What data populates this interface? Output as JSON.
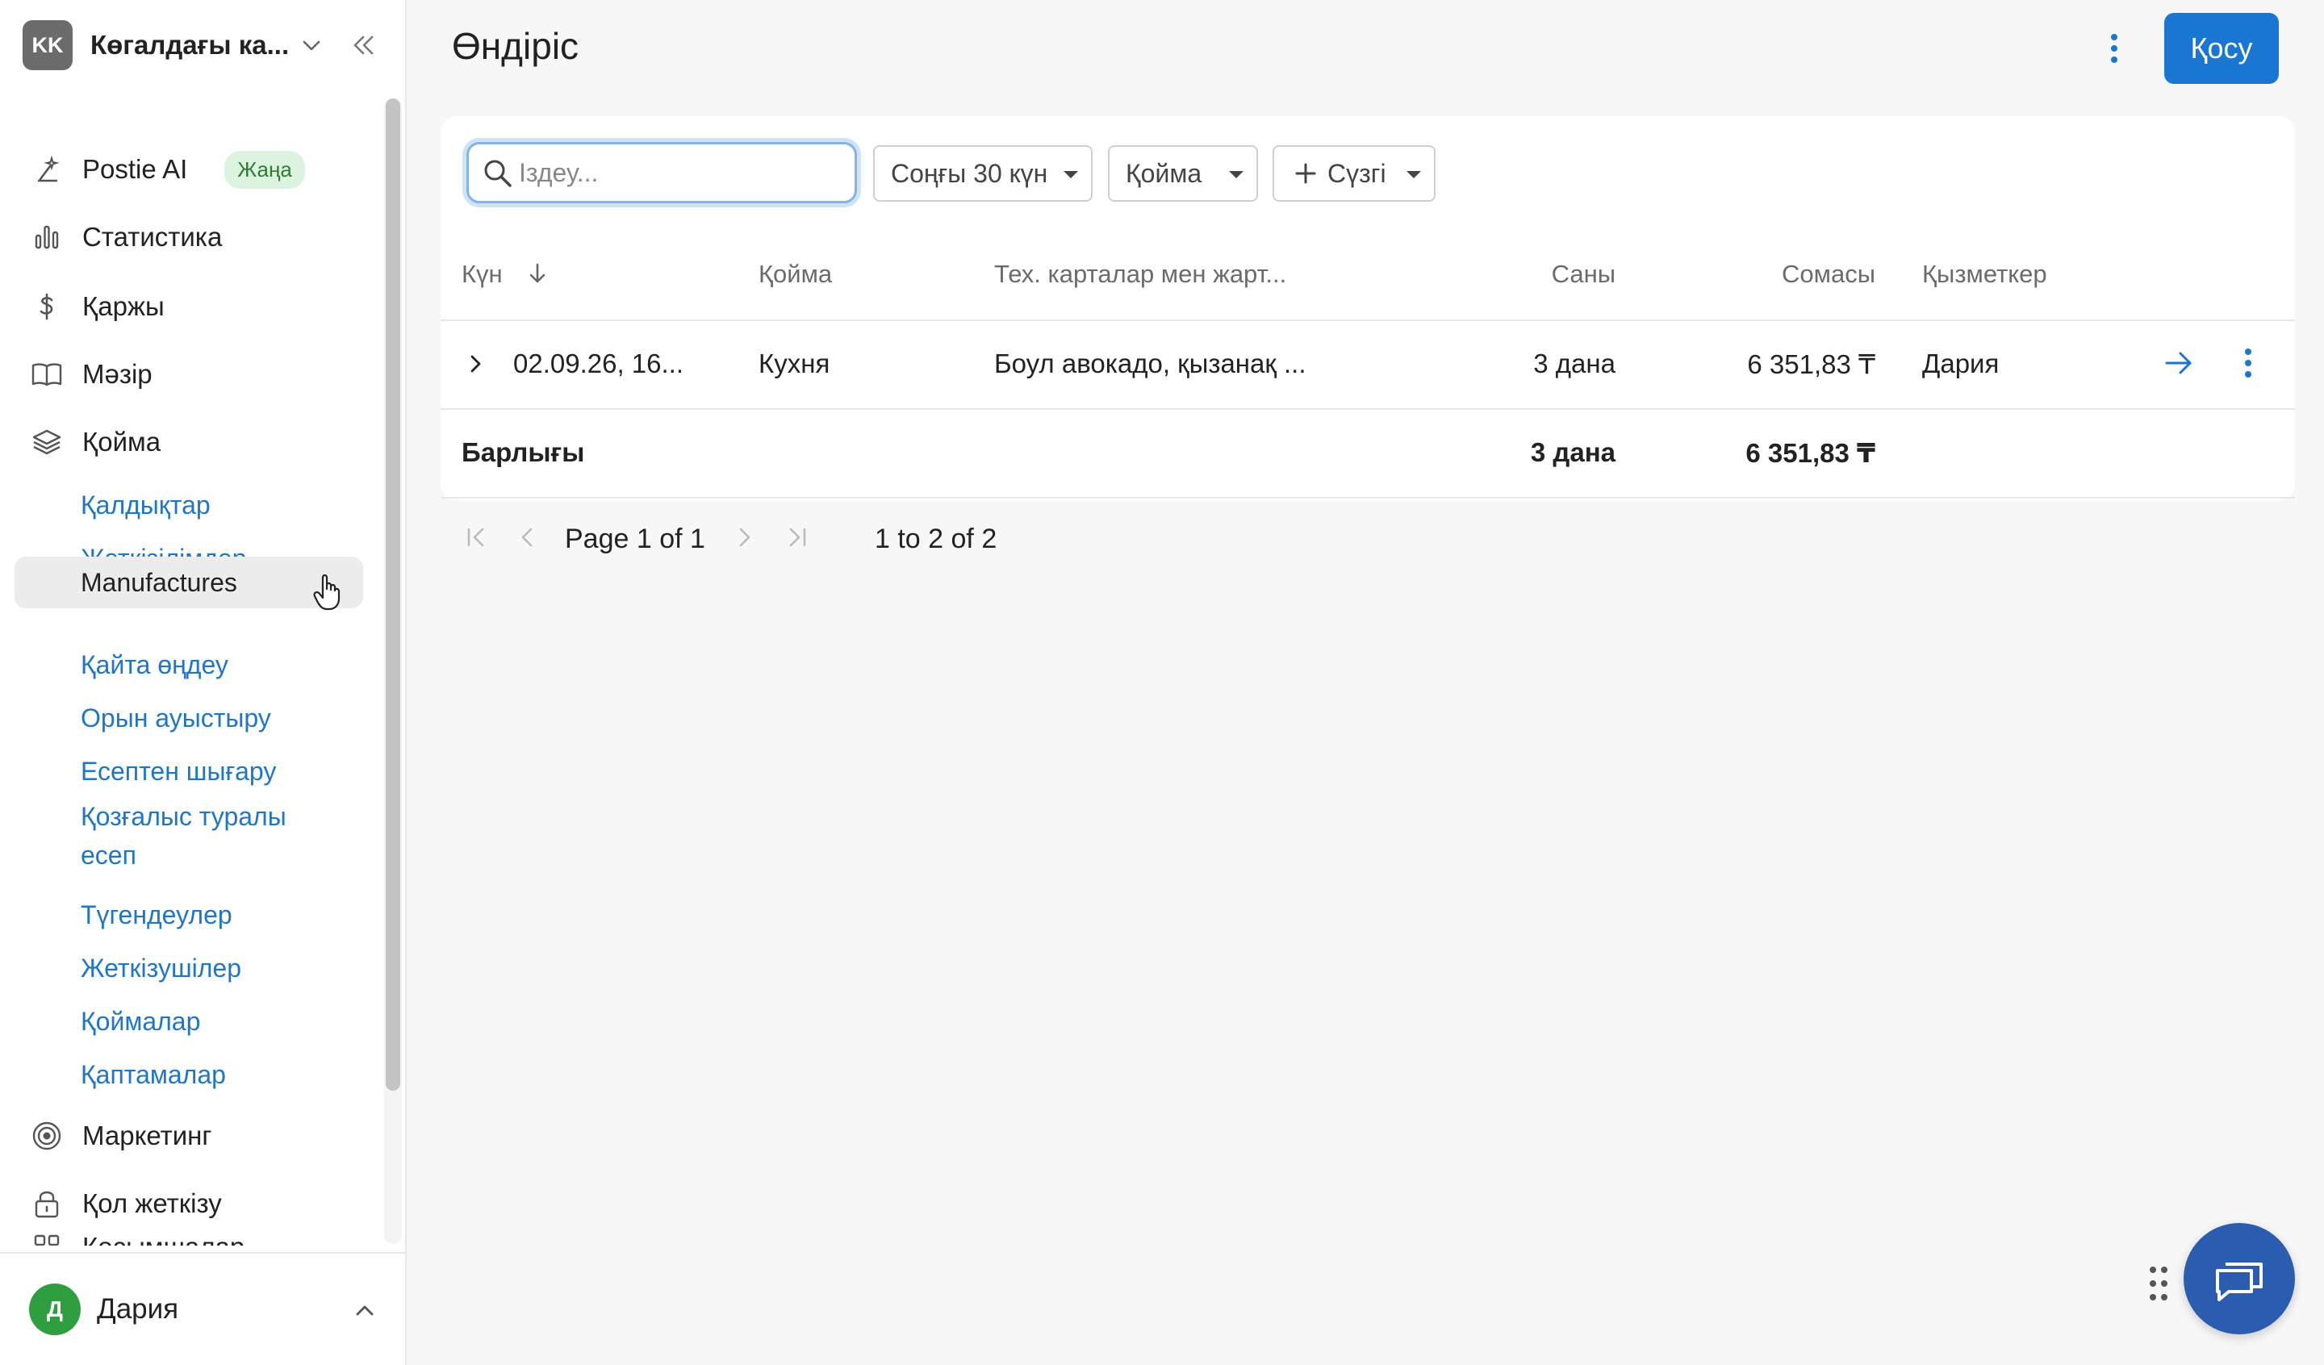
{
  "workspace": {
    "initials": "KK",
    "name": "Көгалдағы ка..."
  },
  "nav": {
    "postie": {
      "label": "Postie AI",
      "badge": "Жаңа"
    },
    "stats": "Статистика",
    "finance": "Қаржы",
    "menu": "Мәзір",
    "warehouse": "Қойма",
    "warehouse_sub": [
      "Қалдықтар",
      "Жеткізілімдер",
      "Manufactures",
      "Қайта өңдеу",
      "Орын ауыстыру",
      "Есептен шығару",
      "Қозғалыс туралы есеп",
      "Түгендеулер",
      "Жеткізушілер",
      "Қоймалар",
      "Қаптамалар"
    ],
    "marketing": "Маркетинг",
    "access": "Қол жеткізу",
    "addons": "Қосымшалар"
  },
  "user": {
    "initial": "Д",
    "name": "Дария"
  },
  "page": {
    "title": "Өндіріс",
    "add_label": "Қосу"
  },
  "search": {
    "placeholder": "Іздеу..."
  },
  "filters": {
    "period": "Соңғы 30 күн",
    "warehouse": "Қойма",
    "filter": "Сүзгі"
  },
  "table": {
    "headers": {
      "date": "Күн",
      "warehouse": "Қойма",
      "cards": "Тех. карталар мен жарт...",
      "qty": "Саны",
      "sum": "Сомасы",
      "employee": "Қызметкер"
    },
    "rows": [
      {
        "date": "02.09.26, 16...",
        "warehouse": "Кухня",
        "cards": "Боул авокадо, қызанақ ...",
        "qty": "3 дана",
        "sum": "6 351,83 ₸",
        "employee": "Дария"
      }
    ],
    "total": {
      "label": "Барлығы",
      "qty": "3 дана",
      "sum": "6 351,83 ₸"
    }
  },
  "pagination": {
    "page_word": "Page",
    "page": "1",
    "of_word": "of",
    "pages": "1",
    "range": "1 to 2 of 2"
  },
  "colors": {
    "accent": "#1976d2",
    "link": "#1f76c9",
    "badge_bg": "#dcf3df",
    "fab": "#2a5db0"
  }
}
